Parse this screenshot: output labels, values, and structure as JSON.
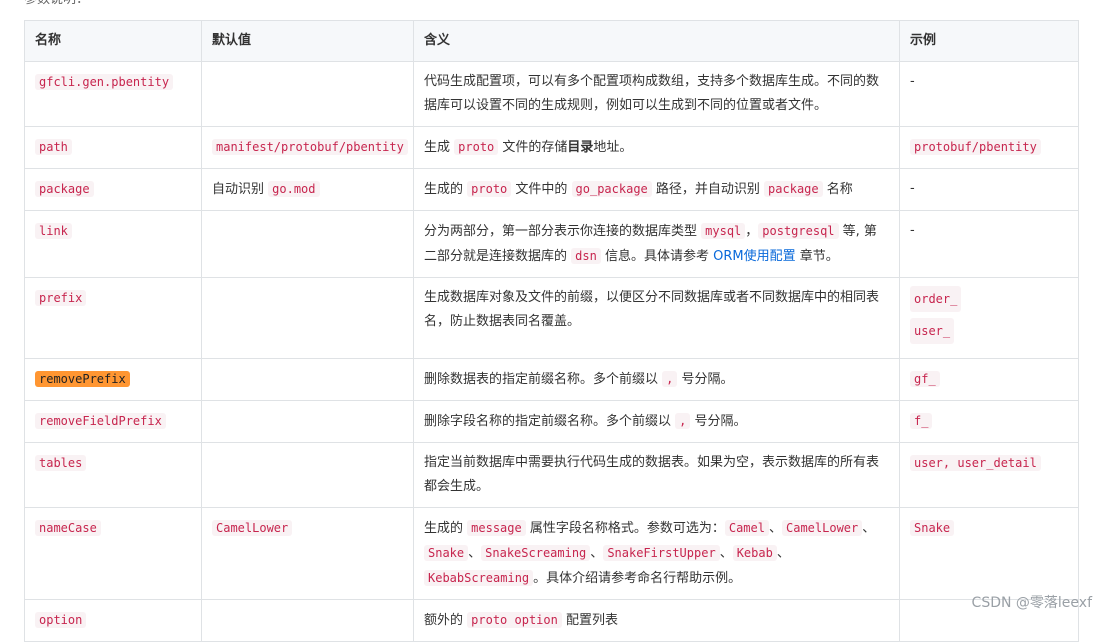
{
  "intro_text": "参数说明：",
  "headers": [
    "名称",
    "默认值",
    "含义",
    "示例"
  ],
  "rows": [
    {
      "name": "gfcli.gen.pbentity",
      "default": "",
      "desc": "代码生成配置项，可以有多个配置项构成数组，支持多个数据库生成。不同的数据库可以设置不同的生成规则，例如可以生成到不同的位置或者文件。",
      "example": "-"
    },
    {
      "name": "path",
      "default_code": "manifest/protobuf/pbentity",
      "desc_parts": [
        "生成 ",
        "proto",
        " 文件的存储",
        "目录",
        "地址。"
      ],
      "example_code": "protobuf/pbentity"
    },
    {
      "name": "package",
      "default_parts": [
        "自动识别 ",
        "go.mod"
      ],
      "desc_parts": [
        "生成的 ",
        "proto",
        " 文件中的 ",
        "go_package",
        " 路径，并自动识别 ",
        "package",
        " 名称"
      ],
      "example": "-"
    },
    {
      "name": "link",
      "desc_parts": [
        "分为两部分，第一部分表示你连接的数据库类型 ",
        "mysql",
        "，",
        "postgresql",
        " 等, 第二部分就是连接数据库的 ",
        "dsn",
        " 信息。具体请参考 ",
        "ORM使用配置",
        " 章节。"
      ],
      "example": "-"
    },
    {
      "name": "prefix",
      "desc": "生成数据库对象及文件的前缀，以便区分不同数据库或者不同数据库中的相同表名，防止数据表同名覆盖。",
      "examples": [
        "order_",
        "user_"
      ]
    },
    {
      "name": "removePrefix",
      "desc_parts": [
        "删除数据表的指定前缀名称。多个前缀以 ",
        ",",
        " 号分隔。"
      ],
      "example_code": "gf_"
    },
    {
      "name": "removeFieldPrefix",
      "desc_parts": [
        "删除字段名称的指定前缀名称。多个前缀以 ",
        ",",
        " 号分隔。"
      ],
      "example_code": "f_"
    },
    {
      "name": "tables",
      "desc": "指定当前数据库中需要执行代码生成的数据表。如果为空，表示数据库的所有表都会生成。",
      "example_code": "user, user_detail"
    },
    {
      "name": "nameCase",
      "default_code": "CamelLower",
      "desc_parts": [
        "生成的 ",
        "message",
        " 属性字段名称格式。参数可选为：",
        "Camel",
        "、",
        "CamelLower",
        "、",
        "Snake",
        "、",
        "SnakeScreaming",
        "、",
        "SnakeFirstUpper",
        "、",
        "Kebab",
        "、",
        "KebabScreaming",
        "。具体介绍请参考命名行帮助示例。"
      ],
      "example_code": "Snake"
    },
    {
      "name": "option",
      "desc_parts": [
        "额外的 ",
        "proto option",
        " 配置列表"
      ],
      "example": ""
    }
  ],
  "watermark": "CSDN @零落leexf",
  "colors": {
    "code_text": "#c7254e",
    "code_bg": "#f9f2f4",
    "highlight": "#ff9632",
    "link": "#0969da",
    "border": "#dfe2e5",
    "header_bg": "#f6f8fa"
  }
}
